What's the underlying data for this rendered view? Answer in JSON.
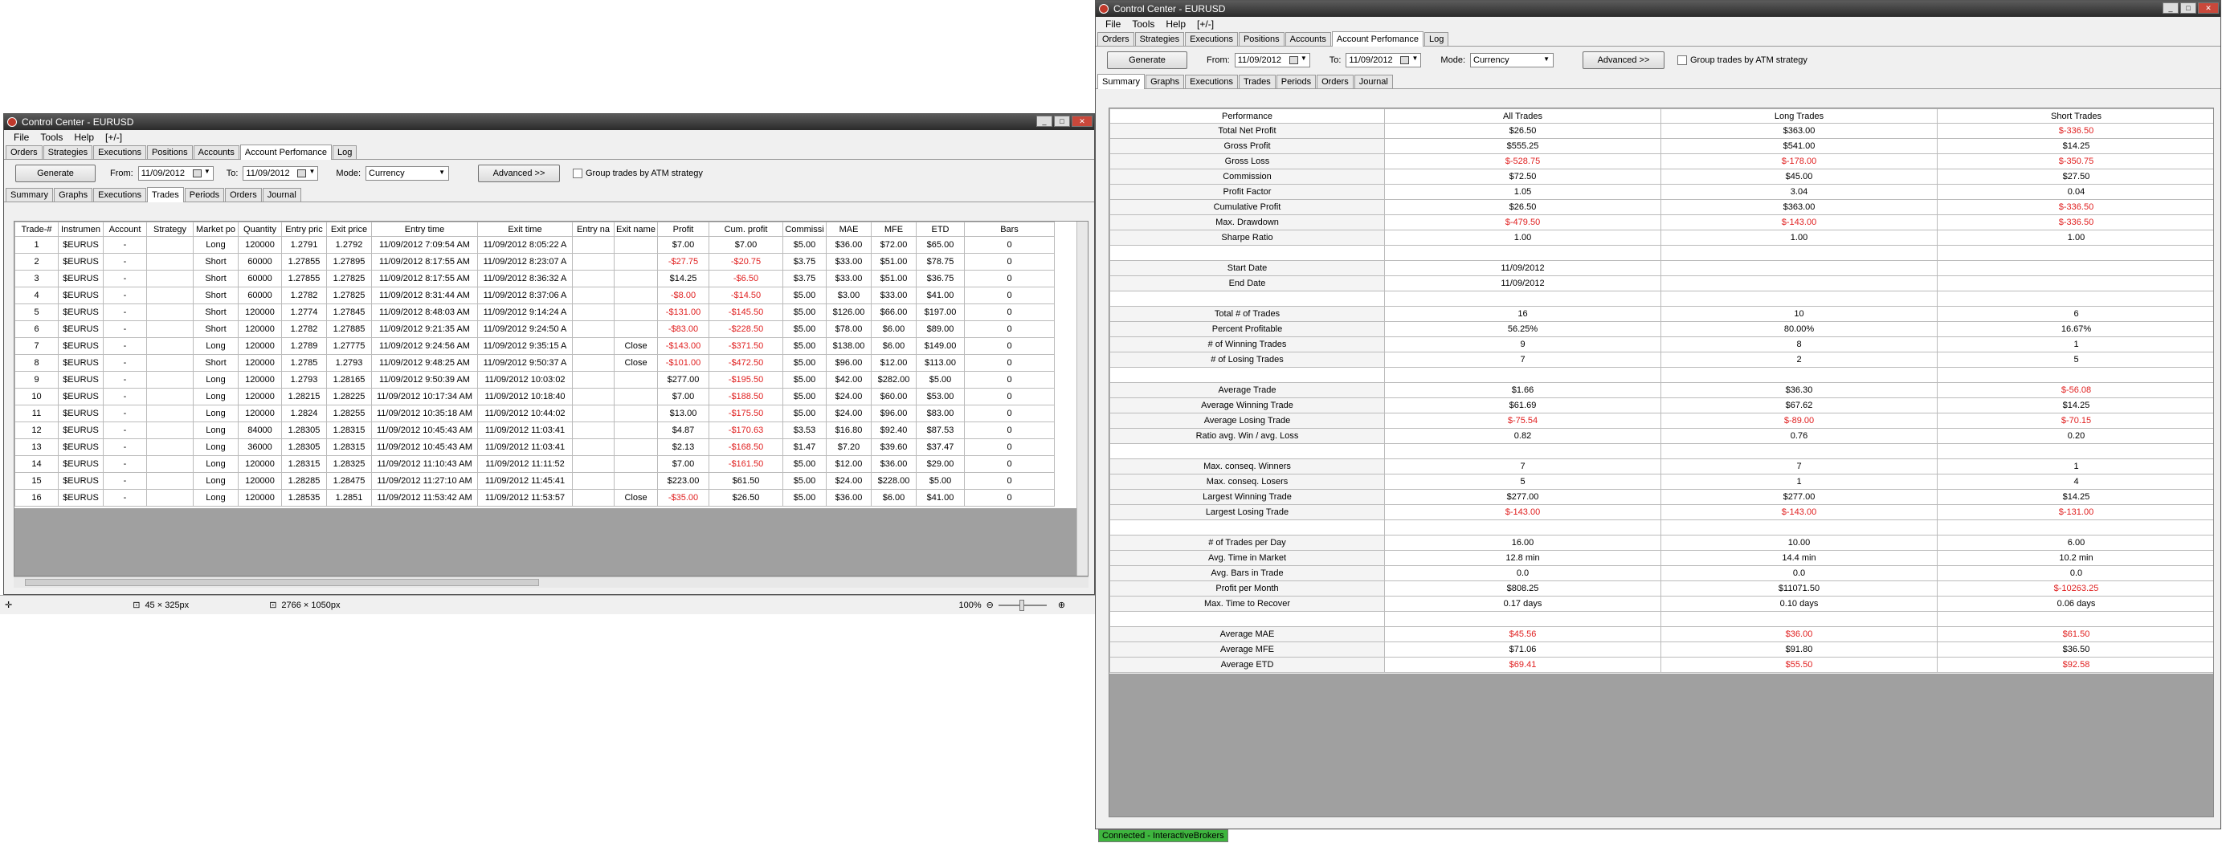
{
  "left": {
    "title": "Control Center - EURUSD",
    "menu": [
      "File",
      "Tools",
      "Help",
      "[+/-]"
    ],
    "main_tabs": [
      "Orders",
      "Strategies",
      "Executions",
      "Positions",
      "Accounts",
      "Account Perfomance",
      "Log"
    ],
    "controls": {
      "generate": "Generate",
      "from_label": "From:",
      "from_value": "11/09/2012",
      "to_label": "To:",
      "to_value": "11/09/2012",
      "mode_label": "Mode:",
      "mode_value": "Currency",
      "advanced": "Advanced >>",
      "group_label": "Group trades by ATM strategy"
    },
    "sub_tabs": [
      "Summary",
      "Graphs",
      "Executions",
      "Trades",
      "Periods",
      "Orders",
      "Journal"
    ],
    "columns": [
      "Trade-#",
      "Instrumen",
      "Account",
      "Strategy",
      "Market po",
      "Quantity",
      "Entry pric",
      "Exit price",
      "Entry time",
      "Exit time",
      "Entry na",
      "Exit name",
      "Profit",
      "Cum. profit",
      "Commissi",
      "MAE",
      "MFE",
      "ETD",
      "Bars"
    ],
    "rows": [
      [
        "1",
        "$EURUS",
        "-",
        "",
        "Long",
        "120000",
        "1.2791",
        "1.2792",
        "11/09/2012 7:09:54 AM",
        "11/09/2012 8:05:22 A",
        "",
        "",
        "$7.00",
        "$7.00",
        "$5.00",
        "$36.00",
        "$72.00",
        "$65.00",
        "0"
      ],
      [
        "2",
        "$EURUS",
        "-",
        "",
        "Short",
        "60000",
        "1.27855",
        "1.27895",
        "11/09/2012 8:17:55 AM",
        "11/09/2012 8:23:07 A",
        "",
        "",
        "-$27.75",
        "-$20.75",
        "$3.75",
        "$33.00",
        "$51.00",
        "$78.75",
        "0"
      ],
      [
        "3",
        "$EURUS",
        "-",
        "",
        "Short",
        "60000",
        "1.27855",
        "1.27825",
        "11/09/2012 8:17:55 AM",
        "11/09/2012 8:36:32 A",
        "",
        "",
        "$14.25",
        "-$6.50",
        "$3.75",
        "$33.00",
        "$51.00",
        "$36.75",
        "0"
      ],
      [
        "4",
        "$EURUS",
        "-",
        "",
        "Short",
        "60000",
        "1.2782",
        "1.27825",
        "11/09/2012 8:31:44 AM",
        "11/09/2012 8:37:06 A",
        "",
        "",
        "-$8.00",
        "-$14.50",
        "$5.00",
        "$3.00",
        "$33.00",
        "$41.00",
        "0"
      ],
      [
        "5",
        "$EURUS",
        "-",
        "",
        "Short",
        "120000",
        "1.2774",
        "1.27845",
        "11/09/2012 8:48:03 AM",
        "11/09/2012 9:14:24 A",
        "",
        "",
        "-$131.00",
        "-$145.50",
        "$5.00",
        "$126.00",
        "$66.00",
        "$197.00",
        "0"
      ],
      [
        "6",
        "$EURUS",
        "-",
        "",
        "Short",
        "120000",
        "1.2782",
        "1.27885",
        "11/09/2012 9:21:35 AM",
        "11/09/2012 9:24:50 A",
        "",
        "",
        "-$83.00",
        "-$228.50",
        "$5.00",
        "$78.00",
        "$6.00",
        "$89.00",
        "0"
      ],
      [
        "7",
        "$EURUS",
        "-",
        "",
        "Long",
        "120000",
        "1.2789",
        "1.27775",
        "11/09/2012 9:24:56 AM",
        "11/09/2012 9:35:15 A",
        "",
        "Close",
        "-$143.00",
        "-$371.50",
        "$5.00",
        "$138.00",
        "$6.00",
        "$149.00",
        "0"
      ],
      [
        "8",
        "$EURUS",
        "-",
        "",
        "Short",
        "120000",
        "1.2785",
        "1.2793",
        "11/09/2012 9:48:25 AM",
        "11/09/2012 9:50:37 A",
        "",
        "Close",
        "-$101.00",
        "-$472.50",
        "$5.00",
        "$96.00",
        "$12.00",
        "$113.00",
        "0"
      ],
      [
        "9",
        "$EURUS",
        "-",
        "",
        "Long",
        "120000",
        "1.2793",
        "1.28165",
        "11/09/2012 9:50:39 AM",
        "11/09/2012 10:03:02",
        "",
        "",
        "$277.00",
        "-$195.50",
        "$5.00",
        "$42.00",
        "$282.00",
        "$5.00",
        "0"
      ],
      [
        "10",
        "$EURUS",
        "-",
        "",
        "Long",
        "120000",
        "1.28215",
        "1.28225",
        "11/09/2012 10:17:34 AM",
        "11/09/2012 10:18:40",
        "",
        "",
        "$7.00",
        "-$188.50",
        "$5.00",
        "$24.00",
        "$60.00",
        "$53.00",
        "0"
      ],
      [
        "11",
        "$EURUS",
        "-",
        "",
        "Long",
        "120000",
        "1.2824",
        "1.28255",
        "11/09/2012 10:35:18 AM",
        "11/09/2012 10:44:02",
        "",
        "",
        "$13.00",
        "-$175.50",
        "$5.00",
        "$24.00",
        "$96.00",
        "$83.00",
        "0"
      ],
      [
        "12",
        "$EURUS",
        "-",
        "",
        "Long",
        "84000",
        "1.28305",
        "1.28315",
        "11/09/2012 10:45:43 AM",
        "11/09/2012 11:03:41",
        "",
        "",
        "$4.87",
        "-$170.63",
        "$3.53",
        "$16.80",
        "$92.40",
        "$87.53",
        "0"
      ],
      [
        "13",
        "$EURUS",
        "-",
        "",
        "Long",
        "36000",
        "1.28305",
        "1.28315",
        "11/09/2012 10:45:43 AM",
        "11/09/2012 11:03:41",
        "",
        "",
        "$2.13",
        "-$168.50",
        "$1.47",
        "$7.20",
        "$39.60",
        "$37.47",
        "0"
      ],
      [
        "14",
        "$EURUS",
        "-",
        "",
        "Long",
        "120000",
        "1.28315",
        "1.28325",
        "11/09/2012 11:10:43 AM",
        "11/09/2012 11:11:52",
        "",
        "",
        "$7.00",
        "-$161.50",
        "$5.00",
        "$12.00",
        "$36.00",
        "$29.00",
        "0"
      ],
      [
        "15",
        "$EURUS",
        "-",
        "",
        "Long",
        "120000",
        "1.28285",
        "1.28475",
        "11/09/2012 11:27:10 AM",
        "11/09/2012 11:45:41",
        "",
        "",
        "$223.00",
        "$61.50",
        "$5.00",
        "$24.00",
        "$228.00",
        "$5.00",
        "0"
      ],
      [
        "16",
        "$EURUS",
        "-",
        "",
        "Long",
        "120000",
        "1.28535",
        "1.2851",
        "11/09/2012 11:53:42 AM",
        "11/09/2012 11:53:57",
        "",
        "Close",
        "-$35.00",
        "$26.50",
        "$5.00",
        "$36.00",
        "$6.00",
        "$41.00",
        "0"
      ]
    ],
    "status": {
      "cursor": "45 × 325px",
      "size": "2766 × 1050px",
      "zoom": "100%"
    }
  },
  "right": {
    "title": "Control Center - EURUSD",
    "menu": [
      "File",
      "Tools",
      "Help",
      "[+/-]"
    ],
    "main_tabs": [
      "Orders",
      "Strategies",
      "Executions",
      "Positions",
      "Accounts",
      "Account Perfomance",
      "Log"
    ],
    "controls": {
      "generate": "Generate",
      "from_label": "From:",
      "from_value": "11/09/2012",
      "to_label": "To:",
      "to_value": "11/09/2012",
      "mode_label": "Mode:",
      "mode_value": "Currency",
      "advanced": "Advanced >>",
      "group_label": "Group trades by ATM strategy"
    },
    "sub_tabs": [
      "Summary",
      "Graphs",
      "Executions",
      "Trades",
      "Periods",
      "Orders",
      "Journal"
    ],
    "columns": [
      "Performance",
      "All Trades",
      "Long Trades",
      "Short Trades"
    ],
    "rows": [
      [
        "Total Net Profit",
        "$26.50",
        "$363.00",
        "$-336.50"
      ],
      [
        "Gross Profit",
        "$555.25",
        "$541.00",
        "$14.25"
      ],
      [
        "Gross Loss",
        "$-528.75",
        "$-178.00",
        "$-350.75"
      ],
      [
        "Commission",
        "$72.50",
        "$45.00",
        "$27.50"
      ],
      [
        "Profit Factor",
        "1.05",
        "3.04",
        "0.04"
      ],
      [
        "Cumulative Profit",
        "$26.50",
        "$363.00",
        "$-336.50"
      ],
      [
        "Max. Drawdown",
        "$-479.50",
        "$-143.00",
        "$-336.50"
      ],
      [
        "Sharpe Ratio",
        "1.00",
        "1.00",
        "1.00"
      ],
      [
        "",
        "",
        "",
        ""
      ],
      [
        "Start Date",
        "11/09/2012",
        "",
        ""
      ],
      [
        "End Date",
        "11/09/2012",
        "",
        ""
      ],
      [
        "",
        "",
        "",
        ""
      ],
      [
        "Total # of Trades",
        "16",
        "10",
        "6"
      ],
      [
        "Percent Profitable",
        "56.25%",
        "80.00%",
        "16.67%"
      ],
      [
        "# of Winning Trades",
        "9",
        "8",
        "1"
      ],
      [
        "# of Losing Trades",
        "7",
        "2",
        "5"
      ],
      [
        "",
        "",
        "",
        ""
      ],
      [
        "Average Trade",
        "$1.66",
        "$36.30",
        "$-56.08"
      ],
      [
        "Average Winning Trade",
        "$61.69",
        "$67.62",
        "$14.25"
      ],
      [
        "Average Losing Trade",
        "$-75.54",
        "$-89.00",
        "$-70.15"
      ],
      [
        "Ratio avg. Win / avg. Loss",
        "0.82",
        "0.76",
        "0.20"
      ],
      [
        "",
        "",
        "",
        ""
      ],
      [
        "Max. conseq. Winners",
        "7",
        "7",
        "1"
      ],
      [
        "Max. conseq. Losers",
        "5",
        "1",
        "4"
      ],
      [
        "Largest Winning Trade",
        "$277.00",
        "$277.00",
        "$14.25"
      ],
      [
        "Largest Losing Trade",
        "$-143.00",
        "$-143.00",
        "$-131.00"
      ],
      [
        "",
        "",
        "",
        ""
      ],
      [
        "# of Trades per Day",
        "16.00",
        "10.00",
        "6.00"
      ],
      [
        "Avg. Time in Market",
        "12.8 min",
        "14.4 min",
        "10.2 min"
      ],
      [
        "Avg. Bars in Trade",
        "0.0",
        "0.0",
        "0.0"
      ],
      [
        "Profit per Month",
        "$808.25",
        "$11071.50",
        "$-10263.25"
      ],
      [
        "Max. Time to Recover",
        "0.17 days",
        "0.10 days",
        "0.06 days"
      ],
      [
        "",
        "",
        "",
        ""
      ],
      [
        "Average MAE",
        "$45.56",
        "$36.00",
        "$61.50"
      ],
      [
        "Average MFE",
        "$71.06",
        "$91.80",
        "$36.50"
      ],
      [
        "Average ETD",
        "$69.41",
        "$55.50",
        "$92.58"
      ]
    ],
    "negative_cells": [
      [
        0,
        3
      ],
      [
        2,
        1
      ],
      [
        2,
        2
      ],
      [
        2,
        3
      ],
      [
        5,
        3
      ],
      [
        6,
        1
      ],
      [
        6,
        2
      ],
      [
        6,
        3
      ],
      [
        17,
        3
      ],
      [
        19,
        1
      ],
      [
        19,
        2
      ],
      [
        19,
        3
      ],
      [
        25,
        1
      ],
      [
        25,
        2
      ],
      [
        25,
        3
      ],
      [
        30,
        3
      ],
      [
        33,
        1
      ],
      [
        33,
        2
      ],
      [
        33,
        3
      ],
      [
        35,
        1
      ],
      [
        35,
        2
      ],
      [
        35,
        3
      ]
    ],
    "connection": "Connected - InteractiveBrokers"
  }
}
